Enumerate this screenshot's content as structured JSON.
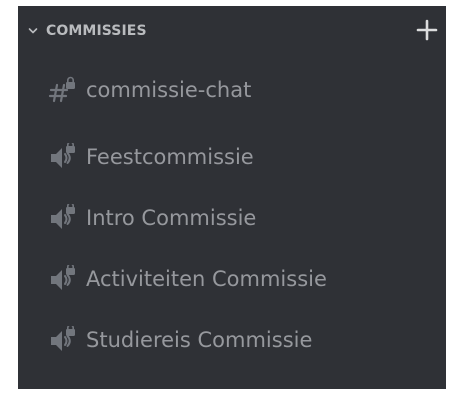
{
  "sidebar": {
    "category": {
      "label": "COMMISSIES",
      "icon": "chevron-down-icon",
      "add_icon": "plus-icon"
    },
    "channels": [
      {
        "type": "text",
        "icon": "text-channel-locked-icon",
        "name": "commissie-chat"
      },
      {
        "type": "voice",
        "icon": "voice-channel-locked-icon",
        "name": "Feestcommissie"
      },
      {
        "type": "voice",
        "icon": "voice-channel-locked-icon",
        "name": "Intro Commissie"
      },
      {
        "type": "voice",
        "icon": "voice-channel-locked-icon",
        "name": "Activiteiten Commissie"
      },
      {
        "type": "voice",
        "icon": "voice-channel-locked-icon",
        "name": "Studiereis Commissie"
      }
    ]
  },
  "colors": {
    "background": "#2f3136",
    "category_text": "#b9bbbe",
    "channel_text": "#96989d",
    "icon": "#72767d",
    "plus": "#dcddde"
  }
}
